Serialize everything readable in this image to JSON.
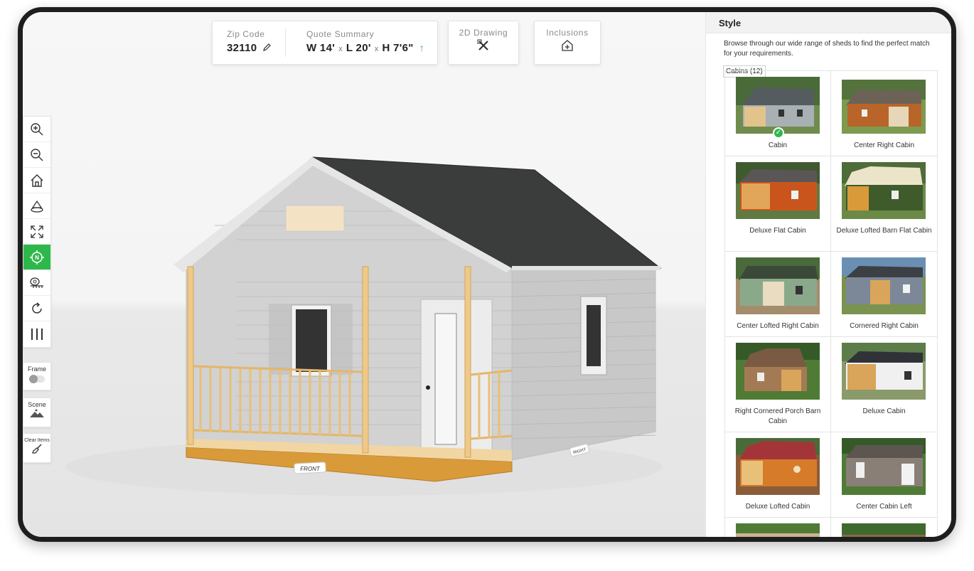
{
  "header": {
    "zip_label": "Zip Code",
    "zip_value": "32110",
    "quote_label": "Quote Summary",
    "quote_w": "W 14'",
    "quote_l": "L 20'",
    "quote_h": "H 7'6\"",
    "quote_sep": "x",
    "drawing_label": "2D Drawing",
    "inclusions_label": "Inclusions"
  },
  "toolbar": {
    "tools": [
      "zoom-in-icon",
      "zoom-out-icon",
      "home-icon",
      "rotate-view-icon",
      "fullscreen-icon",
      "compass-icon",
      "measure-icon",
      "refresh-icon",
      "columns-icon"
    ],
    "frame_label": "Frame",
    "scene_label": "Scene",
    "clear_label": "Clear Items"
  },
  "scene": {
    "front_label": "FRONT",
    "right_label": "RIGHT"
  },
  "panel": {
    "title": "Style",
    "description": "Browse through our wide range of sheds to find the perfect match for your requirements.",
    "category": "Cabins (12)",
    "items": [
      {
        "name": "Cabin",
        "selected": true
      },
      {
        "name": "Center Right Cabin"
      },
      {
        "name": "Deluxe Flat Cabin"
      },
      {
        "name": "Deluxe Lofted Barn Flat Cabin"
      },
      {
        "name": "Center Lofted Right Cabin"
      },
      {
        "name": "Cornered Right Cabin"
      },
      {
        "name": "Right Cornered Porch Barn Cabin"
      },
      {
        "name": "Deluxe Cabin"
      },
      {
        "name": "Deluxe Lofted Cabin"
      },
      {
        "name": "Center Cabin Left"
      }
    ]
  },
  "colors": {
    "accent": "#2eb84b",
    "roof": "#3a3d3c",
    "siding": "#cfcfcf",
    "trim": "#e8c07a"
  }
}
